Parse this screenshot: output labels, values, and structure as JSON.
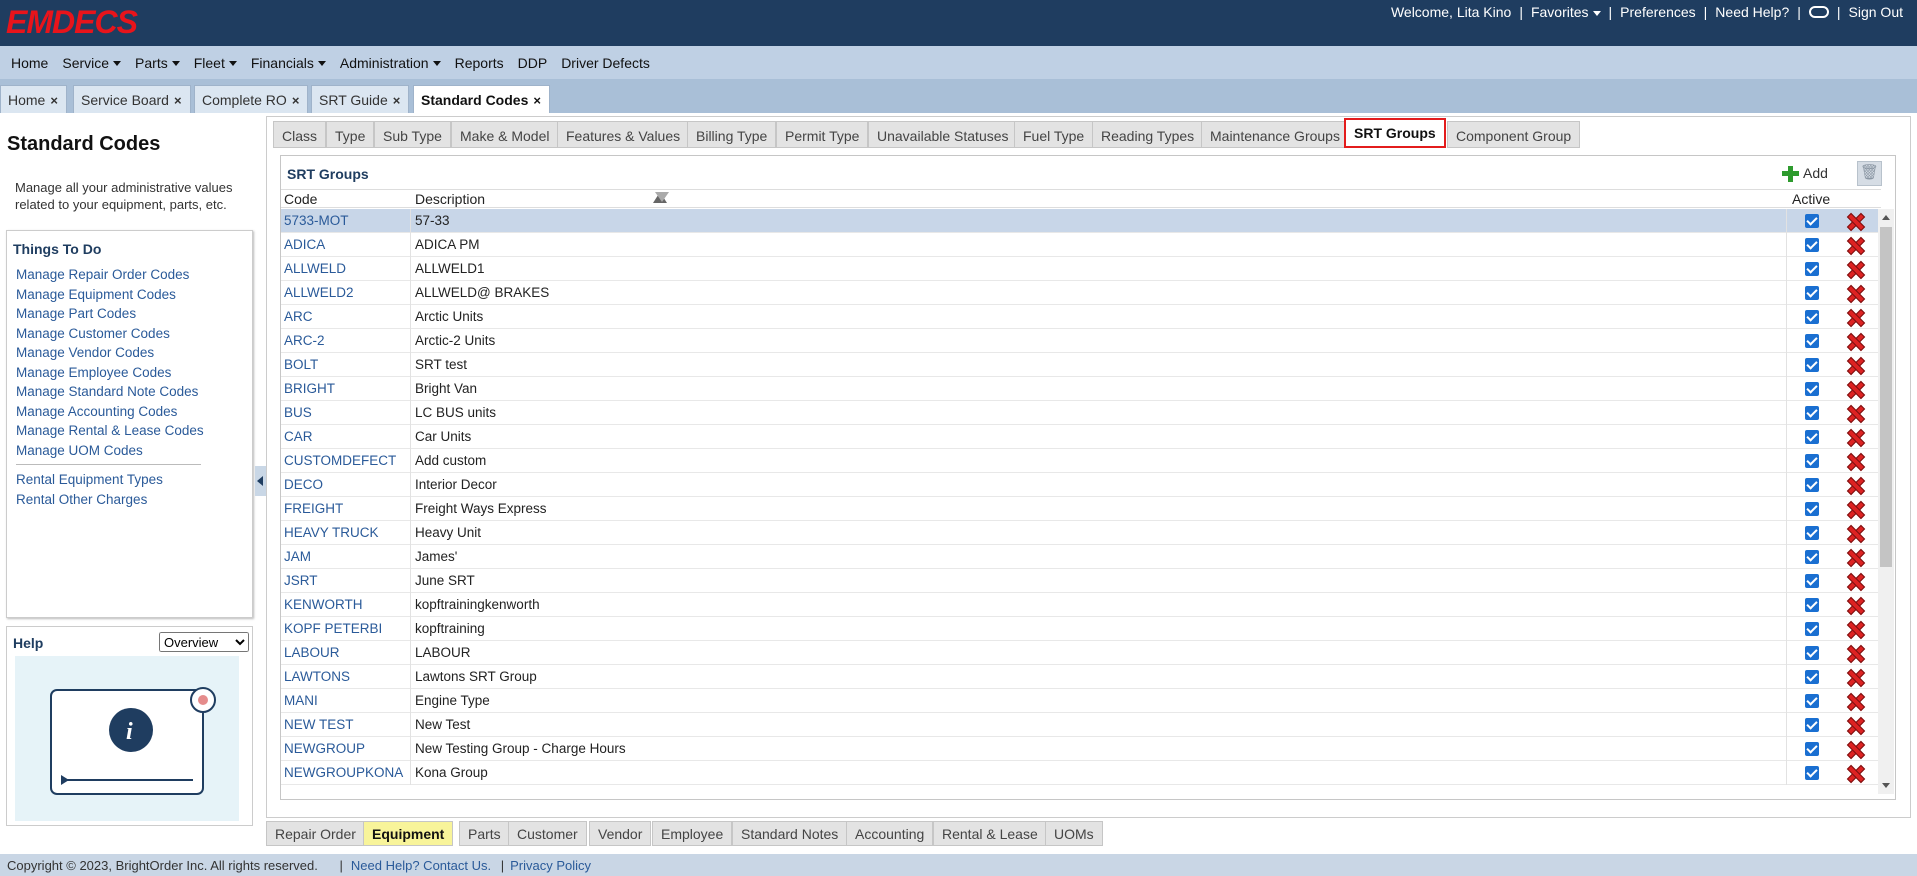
{
  "app": {
    "logo": "EMDECS"
  },
  "topnav": {
    "welcome": "Welcome, Lita Kino",
    "favorites": "Favorites",
    "preferences": "Preferences",
    "need_help": "Need Help?",
    "sign_out": "Sign Out"
  },
  "menu": [
    "Home",
    "Service",
    "Parts",
    "Fleet",
    "Financials",
    "Administration",
    "Reports",
    "DDP",
    "Driver Defects"
  ],
  "page_tabs": [
    "Home",
    "Service Board",
    "Complete RO",
    "SRT Guide",
    "Standard Codes"
  ],
  "left": {
    "title": "Standard Codes",
    "description": "Manage all your administrative values related to your equipment, parts, etc.",
    "things_to_do_title": "Things To Do",
    "links": [
      "Manage Repair Order Codes",
      "Manage Equipment Codes",
      "Manage Part Codes",
      "Manage Customer Codes",
      "Manage Vendor Codes",
      "Manage Employee Codes",
      "Manage Standard Note Codes",
      "Manage Accounting Codes",
      "Manage Rental & Lease Codes",
      "Manage UOM Codes"
    ],
    "links2": [
      "Rental Equipment Types",
      "Rental Other Charges"
    ],
    "help_title": "Help",
    "help_option": "Overview"
  },
  "content_tabs": [
    "Class",
    "Type",
    "Sub Type",
    "Make & Model",
    "Features & Values",
    "Billing Type",
    "Permit Type",
    "Unavailable Statuses",
    "Fuel Type",
    "Reading Types",
    "Maintenance Groups",
    "SRT Groups",
    "Component Group"
  ],
  "grid": {
    "title": "SRT Groups",
    "add_label": "Add",
    "columns": {
      "code": "Code",
      "description": "Description",
      "active": "Active"
    },
    "rows": [
      {
        "code": "5733-MOT",
        "description": "57-33"
      },
      {
        "code": "ADICA",
        "description": "ADICA PM"
      },
      {
        "code": "ALLWELD",
        "description": "ALLWELD1"
      },
      {
        "code": "ALLWELD2",
        "description": "ALLWELD@ BRAKES"
      },
      {
        "code": "ARC",
        "description": "Arctic Units"
      },
      {
        "code": "ARC-2",
        "description": "Arctic-2 Units"
      },
      {
        "code": "BOLT",
        "description": "SRT test"
      },
      {
        "code": "BRIGHT",
        "description": "Bright Van"
      },
      {
        "code": "BUS",
        "description": "LC BUS units"
      },
      {
        "code": "CAR",
        "description": "Car Units"
      },
      {
        "code": "CUSTOMDEFECT",
        "description": "Add custom"
      },
      {
        "code": "DECO",
        "description": "Interior Decor"
      },
      {
        "code": "FREIGHT",
        "description": "Freight Ways Express"
      },
      {
        "code": "HEAVY TRUCK",
        "description": "Heavy Unit"
      },
      {
        "code": "JAM",
        "description": "James'"
      },
      {
        "code": "JSRT",
        "description": "June SRT"
      },
      {
        "code": "KENWORTH",
        "description": "kopftrainingkenworth"
      },
      {
        "code": "KOPF PETERBI",
        "description": "kopftraining"
      },
      {
        "code": "LABOUR",
        "description": "LABOUR"
      },
      {
        "code": "LAWTONS",
        "description": "Lawtons SRT Group"
      },
      {
        "code": "MANI",
        "description": "Engine Type"
      },
      {
        "code": "NEW TEST",
        "description": "New Test"
      },
      {
        "code": "NEWGROUP",
        "description": "New Testing Group - Charge Hours"
      },
      {
        "code": "NEWGROUPKONA",
        "description": "Kona Group"
      }
    ]
  },
  "bottom_tabs": [
    "Repair Order",
    "Equipment",
    "Parts",
    "Customer",
    "Vendor",
    "Employee",
    "Standard Notes",
    "Accounting",
    "Rental & Lease",
    "UOMs"
  ],
  "footer": {
    "copyright": "Copyright © 2023, BrightOrder Inc. All rights reserved.",
    "help_link": "Need Help? Contact Us.",
    "privacy": "Privacy Policy"
  }
}
